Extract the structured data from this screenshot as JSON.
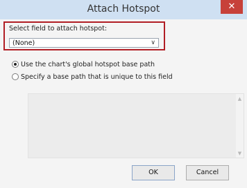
{
  "dialog": {
    "title": "Attach Hotspot",
    "close_label": "✕"
  },
  "field": {
    "label": "Select field to attach hotspot:",
    "selected": "(None)"
  },
  "options": [
    {
      "label": "Use the chart's global hotspot base path",
      "checked": true
    },
    {
      "label": "Specify a base path that is unique to this field",
      "checked": false
    }
  ],
  "buttons": {
    "ok": "OK",
    "cancel": "Cancel"
  },
  "colors": {
    "titlebar": "#cfe0f2",
    "close": "#c7413a",
    "highlight": "#b11d24"
  }
}
